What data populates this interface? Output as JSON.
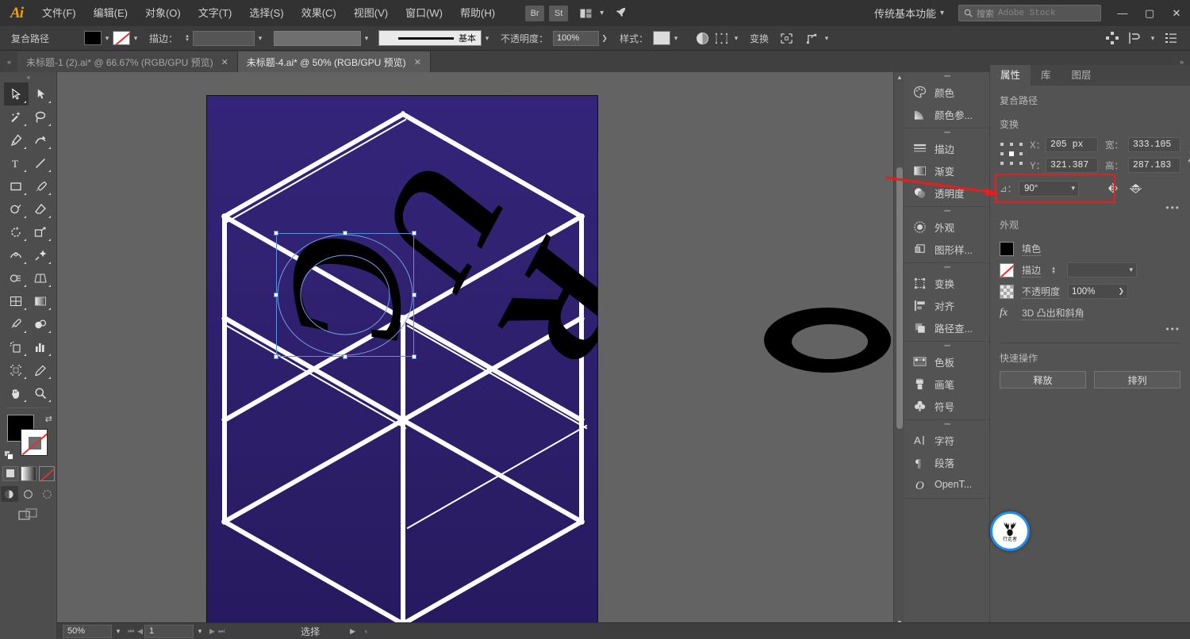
{
  "app": {
    "name": "Adobe Illustrator",
    "logo": "Ai"
  },
  "menubar": {
    "items": [
      {
        "label": "文件(F)",
        "name": "menu-file"
      },
      {
        "label": "编辑(E)",
        "name": "menu-edit"
      },
      {
        "label": "对象(O)",
        "name": "menu-object"
      },
      {
        "label": "文字(T)",
        "name": "menu-type"
      },
      {
        "label": "选择(S)",
        "name": "menu-select"
      },
      {
        "label": "效果(C)",
        "name": "menu-effect"
      },
      {
        "label": "视图(V)",
        "name": "menu-view"
      },
      {
        "label": "窗口(W)",
        "name": "menu-window"
      },
      {
        "label": "帮助(H)",
        "name": "menu-help"
      }
    ],
    "bridge_label": "Br",
    "stock_label": "St",
    "workspace": "传统基本功能",
    "search_placeholder": "搜索",
    "search_brand": "Adobe Stock",
    "window_buttons": {
      "minimize": "—",
      "maximize": "▢",
      "close": "✕"
    }
  },
  "controlbar": {
    "object_type": "复合路径",
    "fill_color": "#000000",
    "stroke_color": "none",
    "stroke_label": "描边：",
    "stroke_weight": "",
    "stroke_profile": "",
    "brush_label": "基本",
    "opacity_label": "不透明度：",
    "opacity_value": "100%",
    "style_label": "样式：",
    "transform_label": "变换",
    "icons": [
      "opacity-mask-icon",
      "align-icon",
      "transform-icon",
      "isolate-icon",
      "anchor-icon"
    ],
    "right_icons": [
      "distribute-icon",
      "arrange-icon",
      "document-setup-icon"
    ]
  },
  "tabs": [
    {
      "title": "未标题-1 (2).ai* @ 66.67% (RGB/GPU 预览)",
      "active": false,
      "close": "✕"
    },
    {
      "title": "未标题-4.ai* @ 50% (RGB/GPU 预览)",
      "active": true,
      "close": "✕"
    }
  ],
  "toolbar": {
    "tools": [
      {
        "name": "selection-tool",
        "selected": true
      },
      {
        "name": "direct-selection-tool",
        "selected": false
      },
      {
        "name": "magic-wand-tool",
        "selected": false
      },
      {
        "name": "lasso-tool",
        "selected": false
      },
      {
        "name": "pen-tool",
        "selected": false
      },
      {
        "name": "curvature-tool",
        "selected": false
      },
      {
        "name": "type-tool",
        "selected": false
      },
      {
        "name": "line-segment-tool",
        "selected": false
      },
      {
        "name": "rectangle-tool",
        "selected": false
      },
      {
        "name": "paintbrush-tool",
        "selected": false
      },
      {
        "name": "shaper-tool",
        "selected": false
      },
      {
        "name": "eraser-tool",
        "selected": false
      },
      {
        "name": "rotate-tool",
        "selected": false
      },
      {
        "name": "scale-tool",
        "selected": false
      },
      {
        "name": "width-tool",
        "selected": false
      },
      {
        "name": "free-transform-tool",
        "selected": false
      },
      {
        "name": "shape-builder-tool",
        "selected": false
      },
      {
        "name": "perspective-grid-tool",
        "selected": false
      },
      {
        "name": "mesh-tool",
        "selected": false
      },
      {
        "name": "gradient-tool",
        "selected": false
      },
      {
        "name": "eyedropper-tool",
        "selected": false
      },
      {
        "name": "blend-tool",
        "selected": false
      },
      {
        "name": "symbol-sprayer-tool",
        "selected": false
      },
      {
        "name": "column-graph-tool",
        "selected": false
      },
      {
        "name": "artboard-tool",
        "selected": false
      },
      {
        "name": "slice-tool",
        "selected": false
      },
      {
        "name": "hand-tool",
        "selected": false
      },
      {
        "name": "zoom-tool",
        "selected": false
      }
    ],
    "fill_color": "#000000",
    "stroke_color": "none",
    "color_modes": [
      "color-mode",
      "gradient-mode",
      "none-mode"
    ],
    "draw_modes": [
      "draw-normal",
      "draw-behind",
      "draw-inside"
    ],
    "screen_mode": "change-screen-mode"
  },
  "canvas": {
    "artboard": {
      "background_color": "#2d1e6b",
      "grid_color": "#ffffff",
      "letters": [
        "C",
        "U",
        "R"
      ],
      "letter_color": "#000000"
    },
    "outside_shape": {
      "name": "black-ellipse-ring",
      "color": "#000000"
    },
    "selection": {
      "handle_color": "#ffffff",
      "box_color": "#5c8fe0"
    }
  },
  "dock": {
    "groups": [
      {
        "items": [
          {
            "label": "颜色",
            "icon": "color-palette-icon",
            "name": "panel-color"
          },
          {
            "label": "颜色参...",
            "icon": "color-guide-icon",
            "name": "panel-color-guide"
          }
        ]
      },
      {
        "items": [
          {
            "label": "描边",
            "icon": "stroke-icon",
            "name": "panel-stroke"
          },
          {
            "label": "渐变",
            "icon": "gradient-icon",
            "name": "panel-gradient"
          },
          {
            "label": "透明度",
            "icon": "transparency-icon",
            "name": "panel-transparency"
          }
        ]
      },
      {
        "items": [
          {
            "label": "外观",
            "icon": "appearance-icon",
            "name": "panel-appearance"
          },
          {
            "label": "图形样...",
            "icon": "graphic-styles-icon",
            "name": "panel-graphic-styles"
          }
        ]
      },
      {
        "items": [
          {
            "label": "变换",
            "icon": "transform-icon",
            "name": "panel-transform"
          },
          {
            "label": "对齐",
            "icon": "align-icon",
            "name": "panel-align"
          },
          {
            "label": "路径查...",
            "icon": "pathfinder-icon",
            "name": "panel-pathfinder"
          }
        ]
      },
      {
        "items": [
          {
            "label": "色板",
            "icon": "swatches-icon",
            "name": "panel-swatches"
          },
          {
            "label": "画笔",
            "icon": "brushes-icon",
            "name": "panel-brushes"
          },
          {
            "label": "符号",
            "icon": "symbols-icon",
            "name": "panel-symbols"
          }
        ]
      },
      {
        "items": [
          {
            "label": "字符",
            "icon": "character-icon",
            "name": "panel-character"
          },
          {
            "label": "段落",
            "icon": "paragraph-icon",
            "name": "panel-paragraph"
          },
          {
            "label": "OpenT...",
            "icon": "opentype-icon",
            "name": "panel-opentype"
          }
        ]
      }
    ]
  },
  "properties": {
    "tabs": [
      {
        "label": "属性",
        "active": true
      },
      {
        "label": "库",
        "active": false
      },
      {
        "label": "图层",
        "active": false
      }
    ],
    "object_type": "复合路径",
    "transform": {
      "heading": "变换",
      "x_label": "X：",
      "x_value": "205 px",
      "y_label": "Y：",
      "y_value": "321.387",
      "w_label": "宽：",
      "w_value": "333.105",
      "h_label": "高：",
      "h_value": "287.183",
      "angle_label": "⊿：",
      "angle_value": "90°",
      "link_icon": "constrain-proportions-icon",
      "flip_h_icon": "flip-horizontal-icon",
      "flip_v_icon": "flip-vertical-icon",
      "more_options": "•••",
      "highlight_color": "#ee1b1b"
    },
    "appearance": {
      "heading": "外观",
      "fill_label": "填色",
      "fill_color": "#000000",
      "stroke_label": "描边",
      "stroke_color": "none",
      "stroke_weight": "",
      "opacity_label": "不透明度",
      "opacity_value": "100%",
      "effect_label": "3D 凸出和斜角",
      "effect_icon": "fx-icon",
      "more_options": "•••"
    },
    "quick_actions": {
      "heading": "快速操作",
      "buttons": [
        {
          "label": "释放",
          "name": "release-button"
        },
        {
          "label": "排列",
          "name": "arrange-button"
        }
      ]
    }
  },
  "statusbar": {
    "zoom": "50%",
    "page": "1",
    "status_text": "选择"
  },
  "watermark": {
    "text": "行走者",
    "icon": "deer-antler-icon",
    "ring_color": "#1f8cf0"
  }
}
